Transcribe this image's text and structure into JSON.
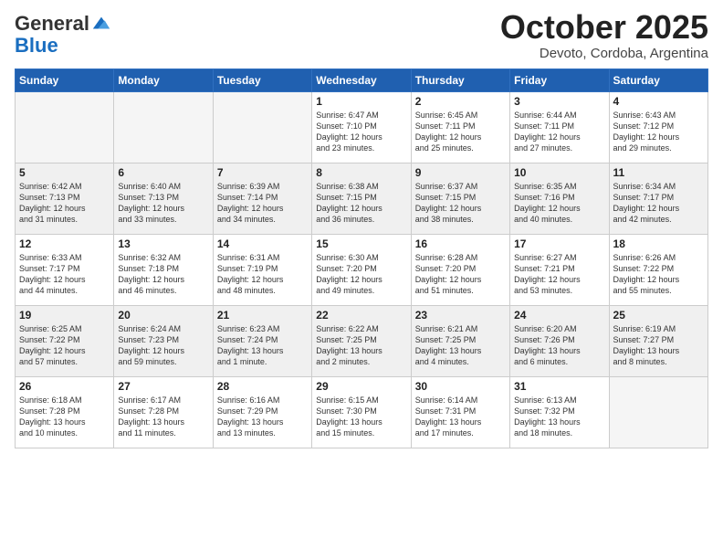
{
  "logo": {
    "general": "General",
    "blue": "Blue"
  },
  "header": {
    "month": "October 2025",
    "location": "Devoto, Cordoba, Argentina"
  },
  "weekdays": [
    "Sunday",
    "Monday",
    "Tuesday",
    "Wednesday",
    "Thursday",
    "Friday",
    "Saturday"
  ],
  "weeks": [
    [
      {
        "day": "",
        "info": ""
      },
      {
        "day": "",
        "info": ""
      },
      {
        "day": "",
        "info": ""
      },
      {
        "day": "1",
        "info": "Sunrise: 6:47 AM\nSunset: 7:10 PM\nDaylight: 12 hours\nand 23 minutes."
      },
      {
        "day": "2",
        "info": "Sunrise: 6:45 AM\nSunset: 7:11 PM\nDaylight: 12 hours\nand 25 minutes."
      },
      {
        "day": "3",
        "info": "Sunrise: 6:44 AM\nSunset: 7:11 PM\nDaylight: 12 hours\nand 27 minutes."
      },
      {
        "day": "4",
        "info": "Sunrise: 6:43 AM\nSunset: 7:12 PM\nDaylight: 12 hours\nand 29 minutes."
      }
    ],
    [
      {
        "day": "5",
        "info": "Sunrise: 6:42 AM\nSunset: 7:13 PM\nDaylight: 12 hours\nand 31 minutes."
      },
      {
        "day": "6",
        "info": "Sunrise: 6:40 AM\nSunset: 7:13 PM\nDaylight: 12 hours\nand 33 minutes."
      },
      {
        "day": "7",
        "info": "Sunrise: 6:39 AM\nSunset: 7:14 PM\nDaylight: 12 hours\nand 34 minutes."
      },
      {
        "day": "8",
        "info": "Sunrise: 6:38 AM\nSunset: 7:15 PM\nDaylight: 12 hours\nand 36 minutes."
      },
      {
        "day": "9",
        "info": "Sunrise: 6:37 AM\nSunset: 7:15 PM\nDaylight: 12 hours\nand 38 minutes."
      },
      {
        "day": "10",
        "info": "Sunrise: 6:35 AM\nSunset: 7:16 PM\nDaylight: 12 hours\nand 40 minutes."
      },
      {
        "day": "11",
        "info": "Sunrise: 6:34 AM\nSunset: 7:17 PM\nDaylight: 12 hours\nand 42 minutes."
      }
    ],
    [
      {
        "day": "12",
        "info": "Sunrise: 6:33 AM\nSunset: 7:17 PM\nDaylight: 12 hours\nand 44 minutes."
      },
      {
        "day": "13",
        "info": "Sunrise: 6:32 AM\nSunset: 7:18 PM\nDaylight: 12 hours\nand 46 minutes."
      },
      {
        "day": "14",
        "info": "Sunrise: 6:31 AM\nSunset: 7:19 PM\nDaylight: 12 hours\nand 48 minutes."
      },
      {
        "day": "15",
        "info": "Sunrise: 6:30 AM\nSunset: 7:20 PM\nDaylight: 12 hours\nand 49 minutes."
      },
      {
        "day": "16",
        "info": "Sunrise: 6:28 AM\nSunset: 7:20 PM\nDaylight: 12 hours\nand 51 minutes."
      },
      {
        "day": "17",
        "info": "Sunrise: 6:27 AM\nSunset: 7:21 PM\nDaylight: 12 hours\nand 53 minutes."
      },
      {
        "day": "18",
        "info": "Sunrise: 6:26 AM\nSunset: 7:22 PM\nDaylight: 12 hours\nand 55 minutes."
      }
    ],
    [
      {
        "day": "19",
        "info": "Sunrise: 6:25 AM\nSunset: 7:22 PM\nDaylight: 12 hours\nand 57 minutes."
      },
      {
        "day": "20",
        "info": "Sunrise: 6:24 AM\nSunset: 7:23 PM\nDaylight: 12 hours\nand 59 minutes."
      },
      {
        "day": "21",
        "info": "Sunrise: 6:23 AM\nSunset: 7:24 PM\nDaylight: 13 hours\nand 1 minute."
      },
      {
        "day": "22",
        "info": "Sunrise: 6:22 AM\nSunset: 7:25 PM\nDaylight: 13 hours\nand 2 minutes."
      },
      {
        "day": "23",
        "info": "Sunrise: 6:21 AM\nSunset: 7:25 PM\nDaylight: 13 hours\nand 4 minutes."
      },
      {
        "day": "24",
        "info": "Sunrise: 6:20 AM\nSunset: 7:26 PM\nDaylight: 13 hours\nand 6 minutes."
      },
      {
        "day": "25",
        "info": "Sunrise: 6:19 AM\nSunset: 7:27 PM\nDaylight: 13 hours\nand 8 minutes."
      }
    ],
    [
      {
        "day": "26",
        "info": "Sunrise: 6:18 AM\nSunset: 7:28 PM\nDaylight: 13 hours\nand 10 minutes."
      },
      {
        "day": "27",
        "info": "Sunrise: 6:17 AM\nSunset: 7:28 PM\nDaylight: 13 hours\nand 11 minutes."
      },
      {
        "day": "28",
        "info": "Sunrise: 6:16 AM\nSunset: 7:29 PM\nDaylight: 13 hours\nand 13 minutes."
      },
      {
        "day": "29",
        "info": "Sunrise: 6:15 AM\nSunset: 7:30 PM\nDaylight: 13 hours\nand 15 minutes."
      },
      {
        "day": "30",
        "info": "Sunrise: 6:14 AM\nSunset: 7:31 PM\nDaylight: 13 hours\nand 17 minutes."
      },
      {
        "day": "31",
        "info": "Sunrise: 6:13 AM\nSunset: 7:32 PM\nDaylight: 13 hours\nand 18 minutes."
      },
      {
        "day": "",
        "info": ""
      }
    ]
  ]
}
